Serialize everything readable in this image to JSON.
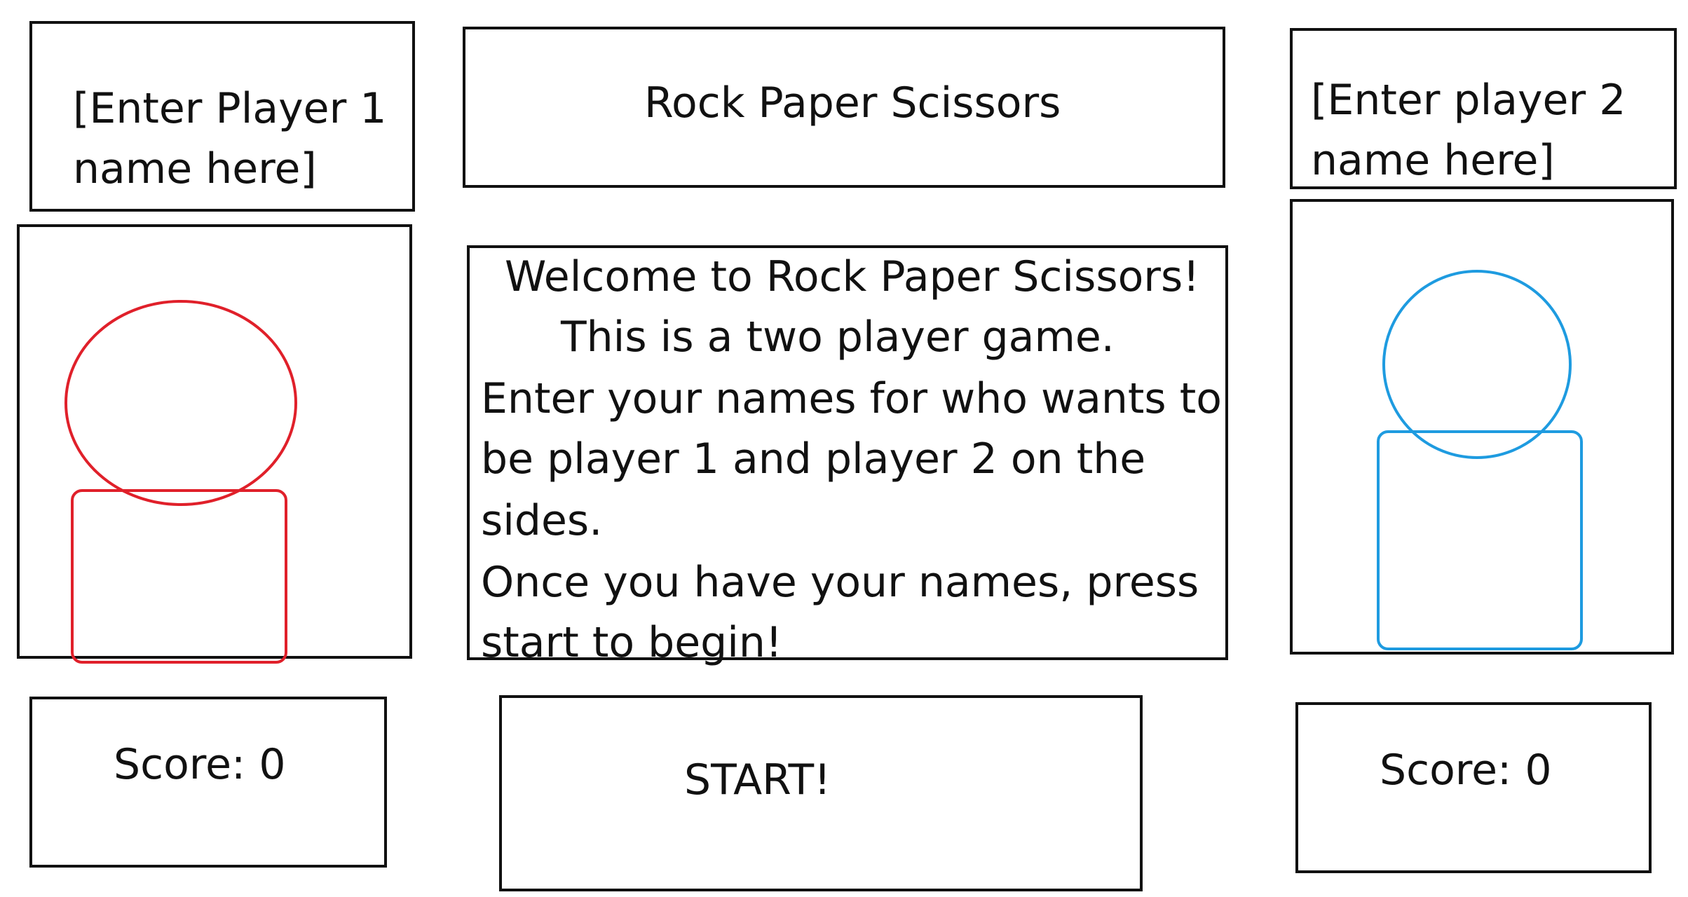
{
  "header": {
    "player1_name_placeholder_line1": "[Enter Player 1",
    "player1_name_placeholder_line2": "name here]",
    "title": "Rock Paper Scissors",
    "player2_name_placeholder_line1": "[Enter player 2",
    "player2_name_placeholder_line2": "name here]"
  },
  "welcome": {
    "lines": [
      "Welcome to Rock Paper Scissors!",
      "This is a two player game.",
      "Enter your names for who wants to",
      "be player 1 and player 2 on the",
      "sides.",
      "Once you have your names, press",
      "start to begin!"
    ]
  },
  "player1": {
    "avatar_icon": "player-avatar-icon",
    "avatar_color": "#e0202a",
    "score_label": "Score: 0"
  },
  "player2": {
    "avatar_icon": "player-avatar-icon",
    "avatar_color": "#1e9be0",
    "score_label": "Score: 0"
  },
  "controls": {
    "start_label": "START!"
  }
}
